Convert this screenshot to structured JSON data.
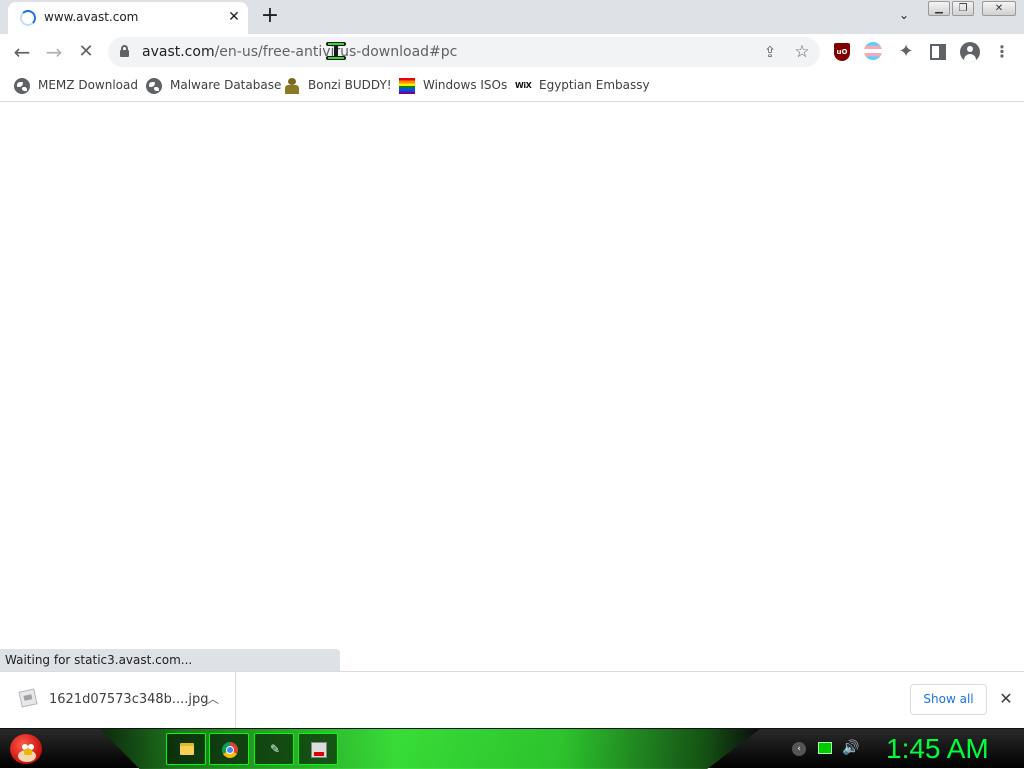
{
  "browser": {
    "tab": {
      "title": "www.avast.com",
      "loading": true
    },
    "omnibox": {
      "url_domain": "avast.com",
      "url_path": "/en-us/free-antivirus-download#pc"
    },
    "extensions": {
      "ublock_badge": "uO"
    },
    "bookmarks": [
      {
        "label": "MEMZ Download",
        "icon": "globe-icon"
      },
      {
        "label": "Malware Database",
        "icon": "globe-icon"
      },
      {
        "label": "Bonzi BUDDY!",
        "icon": "bonzi-icon"
      },
      {
        "label": "Windows ISOs",
        "icon": "rainbow-flag-icon"
      },
      {
        "label": "Egyptian Embassy",
        "icon": "wix-icon",
        "icon_text": "WiX"
      }
    ]
  },
  "status_bar": {
    "text": "Waiting for static3.avast.com..."
  },
  "download_shelf": {
    "item": {
      "filename": "1621d07573c348b....jpg"
    },
    "show_all_label": "Show all"
  },
  "taskbar": {
    "clock": "1:45 AM",
    "apps": [
      "folder-icon",
      "chrome-icon",
      "app-icon",
      "app-icon"
    ]
  },
  "colors": {
    "accent": "#1a73e8",
    "taskbar_glow": "#39e639",
    "clock": "#00ff3a",
    "ublock": "#800000"
  }
}
